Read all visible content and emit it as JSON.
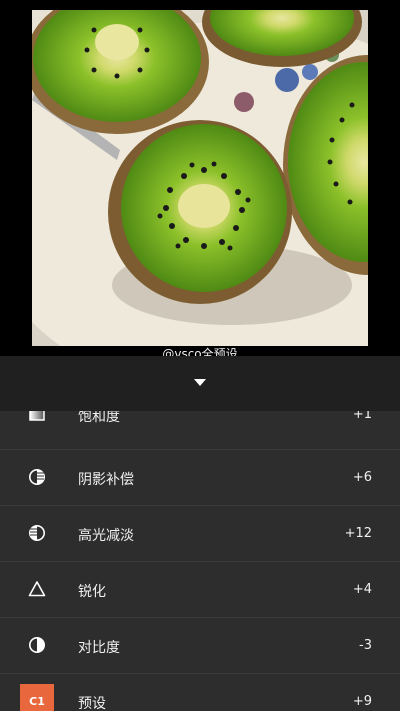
{
  "watermark": "@vsco全预设",
  "adjustments": [
    {
      "label": "饱和度",
      "value": "+1",
      "icon": "saturation-icon"
    },
    {
      "label": "阴影补偿",
      "value": "+6",
      "icon": "shadows-icon"
    },
    {
      "label": "高光减淡",
      "value": "+12",
      "icon": "highlights-icon"
    },
    {
      "label": "锐化",
      "value": "+4",
      "icon": "sharpen-icon"
    },
    {
      "label": "对比度",
      "value": "-3",
      "icon": "contrast-icon"
    },
    {
      "label": "预设",
      "value": "+9",
      "icon": "preset-badge",
      "badge": "C1"
    }
  ],
  "colors": {
    "badge": "#e8673c",
    "kiwi": "#6fa51e",
    "panel": "#2d2d2d"
  }
}
